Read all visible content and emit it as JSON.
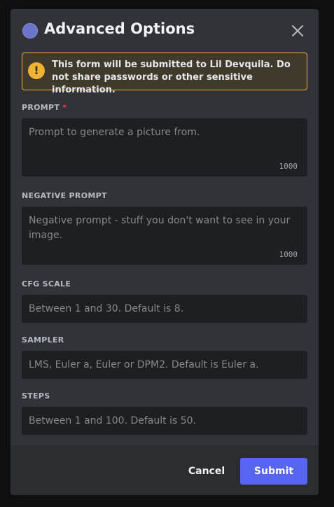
{
  "header": {
    "title": "Advanced Options",
    "close_icon": "close-icon",
    "avatar_color": "#6b74c8"
  },
  "warning": {
    "icon": "exclamation-icon",
    "text": "This form will be submitted to Lil Devquila. Do not share passwords or other sensitive information.",
    "border_color": "#f0b232"
  },
  "fields": {
    "prompt": {
      "label": "PROMPT",
      "required_mark": "*",
      "placeholder": "Prompt to generate a picture from.",
      "counter": "1000"
    },
    "negative_prompt": {
      "label": "NEGATIVE PROMPT",
      "placeholder": "Negative prompt - stuff you don't want to see in your image.",
      "counter": "1000"
    },
    "cfg_scale": {
      "label": "CFG SCALE",
      "placeholder": "Between 1 and 30. Default is 8."
    },
    "sampler": {
      "label": "SAMPLER",
      "placeholder": "LMS, Euler a, Euler or DPM2. Default is Euler a."
    },
    "steps": {
      "label": "STEPS",
      "placeholder": "Between 1 and 100. Default is 50."
    }
  },
  "footer": {
    "cancel_label": "Cancel",
    "submit_label": "Submit",
    "accent": "#5865f2"
  }
}
